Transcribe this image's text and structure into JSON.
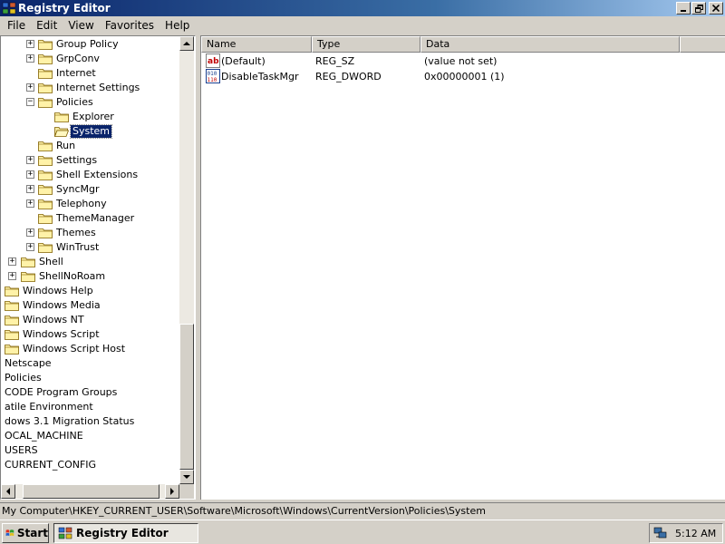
{
  "window": {
    "title": "Registry Editor"
  },
  "menu": [
    "File",
    "Edit",
    "View",
    "Favorites",
    "Help"
  ],
  "tree": [
    {
      "label": "Group Policy",
      "expander": "+"
    },
    {
      "label": "GrpConv",
      "expander": "+"
    },
    {
      "label": "Internet",
      "expander": ""
    },
    {
      "label": "Internet Settings",
      "expander": "+"
    },
    {
      "label": "Policies",
      "expander": "−"
    },
    {
      "label": "Explorer",
      "expander": ""
    },
    {
      "label": "System",
      "expander": "",
      "selected": true
    },
    {
      "label": "Run",
      "expander": ""
    },
    {
      "label": "Settings",
      "expander": "+"
    },
    {
      "label": "Shell Extensions",
      "expander": "+"
    },
    {
      "label": "SyncMgr",
      "expander": "+"
    },
    {
      "label": "Telephony",
      "expander": "+"
    },
    {
      "label": "ThemeManager",
      "expander": ""
    },
    {
      "label": "Themes",
      "expander": "+"
    },
    {
      "label": "WinTrust",
      "expander": "+"
    },
    {
      "label": "Shell",
      "expander": "+"
    },
    {
      "label": "ShellNoRoam",
      "expander": "+"
    },
    {
      "label": "Windows Help",
      "expander": ""
    },
    {
      "label": "Windows Media",
      "expander": ""
    },
    {
      "label": "Windows NT",
      "expander": ""
    },
    {
      "label": "Windows Script",
      "expander": ""
    },
    {
      "label": "Windows Script Host",
      "expander": ""
    },
    {
      "label": "Netscape",
      "expander": ""
    },
    {
      "label": "Policies",
      "expander": ""
    },
    {
      "label": "CODE Program Groups",
      "expander": ""
    },
    {
      "label": "atile Environment",
      "expander": ""
    },
    {
      "label": "dows 3.1 Migration Status",
      "expander": ""
    },
    {
      "label": "OCAL_MACHINE",
      "expander": ""
    },
    {
      "label": "USERS",
      "expander": ""
    },
    {
      "label": "CURRENT_CONFIG",
      "expander": ""
    }
  ],
  "columns": [
    "Name",
    "Type",
    "Data"
  ],
  "values": [
    {
      "name": "(Default)",
      "type": "REG_SZ",
      "data": "(value not set)",
      "icon": "string-value-icon"
    },
    {
      "name": "DisableTaskMgr",
      "type": "REG_DWORD",
      "data": "0x00000001 (1)",
      "icon": "dword-value-icon"
    }
  ],
  "status": "My Computer\\HKEY_CURRENT_USER\\Software\\Microsoft\\Windows\\CurrentVersion\\Policies\\System",
  "taskbar": {
    "start": "Start",
    "task": "Registry Editor",
    "clock": "5:12 AM"
  }
}
